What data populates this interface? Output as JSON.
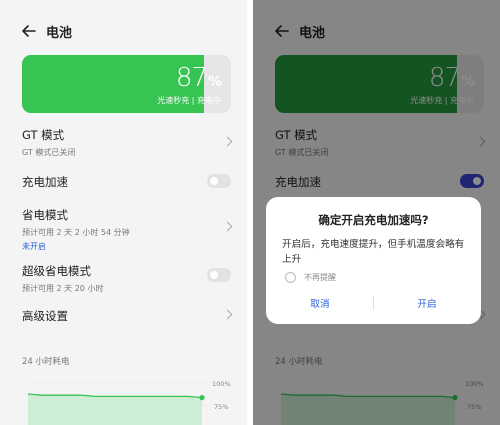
{
  "header": {
    "title": "电池"
  },
  "battery": {
    "percent_number": "87",
    "percent_sign": "%",
    "level": 0.87,
    "status_text": "光速秒充  |  充电中",
    "fill_color_left": "#37c453",
    "fill_color_right": "#259a40",
    "empty_color": "#e6e6e6"
  },
  "settings": {
    "gt_mode": {
      "label": "GT 模式",
      "sub": "GT 模式已关闭"
    },
    "charge_boost": {
      "label": "充电加速",
      "enabled_left": false,
      "enabled_right": true
    },
    "power_saving": {
      "label": "省电模式",
      "sub": "预计可用 2 天 2 小时 54 分钟",
      "status": "未开启"
    },
    "super_power_saving": {
      "label": "超级省电模式",
      "sub": "预计可用 2 天 20 小时"
    },
    "advanced": {
      "label": "高级设置"
    }
  },
  "usage": {
    "title": "24 小时耗电",
    "tick_100": "100%",
    "tick_75": "75%"
  },
  "chart_data": {
    "type": "area",
    "title": "24 小时耗电",
    "y_ticks": [
      "100%",
      "75%"
    ],
    "ylim": [
      60,
      100
    ],
    "values": [
      90,
      89,
      89,
      89,
      89,
      88,
      88,
      88,
      88,
      88,
      88,
      88,
      88,
      87
    ],
    "color": "#37c453"
  },
  "dialog": {
    "title": "确定开启充电加速吗?",
    "body": "开启后，充电速度提升，但手机温度会略有上升",
    "checkbox_label": "不再提醒",
    "cancel": "取消",
    "confirm": "开启"
  },
  "icons": {
    "back": "back-arrow-icon",
    "chevron": "chevron-right-icon"
  },
  "colors": {
    "accent_blue": "#2a5fd8",
    "toggle_on": "#3a42d2"
  }
}
